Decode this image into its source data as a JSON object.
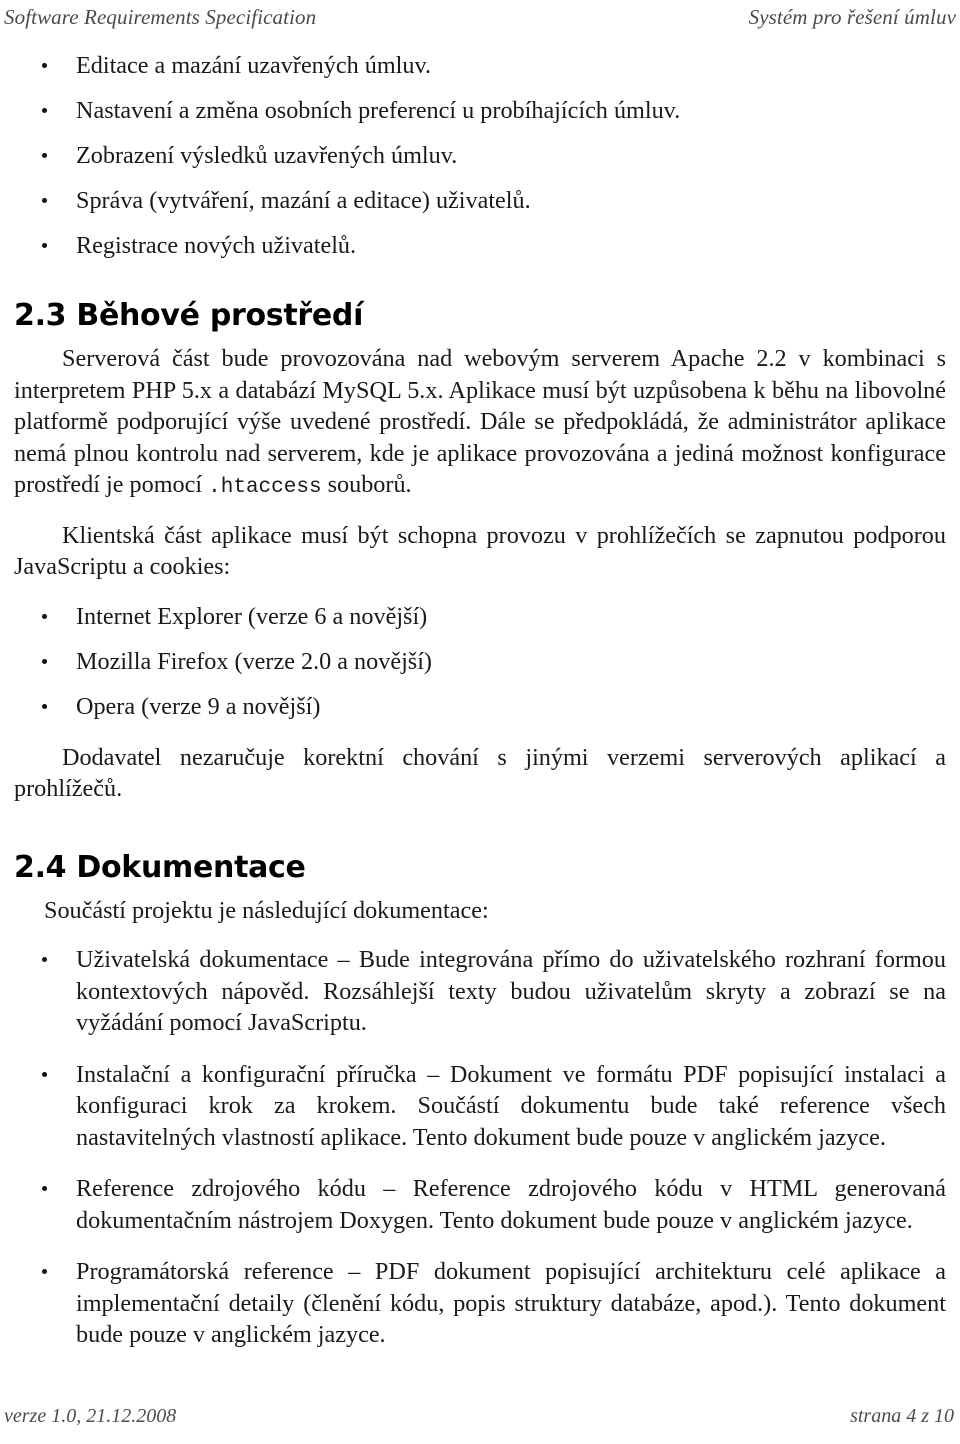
{
  "header": {
    "left": "Software Requirements Specification",
    "right": "Systém pro řešení úmluv"
  },
  "footer": {
    "left": "verze 1.0, 21.12.2008",
    "right": "strana 4 z 10"
  },
  "top_list": {
    "items": [
      "Editace a mazání uzavřených úmluv.",
      "Nastavení a změna osobních preferencí u probíhajících úmluv.",
      "Zobrazení výsledků uzavřených úmluv.",
      "Správa (vytváření, mazání a editace) uživatelů.",
      "Registrace nových uživatelů."
    ]
  },
  "section_23": {
    "heading": "2.3 Běhové prostředí",
    "para1_before_code": "Serverová část bude provozována nad webovým serverem Apache 2.2 v kombinaci s interpretem PHP 5.x a databází MySQL 5.x. Aplikace musí být uzpůsobena k běhu na libovolné platformě podporující výše uvedené prostředí. Dále se předpokládá, že administrátor aplikace nemá plnou kontrolu nad serverem, kde je aplikace provozována a jediná možnost konfigurace prostředí je pomocí ",
    "para1_code": ".htaccess",
    "para1_after_code": " souborů.",
    "para2": "Klientská část aplikace musí být schopna provozu v prohlížečích se zapnutou podporou JavaScriptu a cookies:",
    "browsers": [
      "Internet Explorer (verze 6 a novější)",
      "Mozilla Firefox (verze 2.0 a novější)",
      "Opera (verze 9 a novější)"
    ],
    "para3": "Dodavatel nezaručuje korektní chování s jinými verzemi serverových aplikací a prohlížečů."
  },
  "section_24": {
    "heading": "2.4 Dokumentace",
    "intro": "Součástí projektu je následující dokumentace:",
    "docs": [
      "Uživatelská dokumentace – Bude integrována přímo do uživatelského rozhraní formou kontextových nápověd. Rozsáhlejší texty budou uživatelům skryty a zobrazí se na vyžádání pomocí JavaScriptu.",
      "Instalační a konfigurační příručka – Dokument ve formátu PDF popisující instalaci a konfiguraci krok za krokem. Součástí dokumentu bude také reference všech nastavitelných vlastností aplikace. Tento dokument bude pouze v anglickém jazyce.",
      "Reference zdrojového kódu – Reference zdrojového kódu v HTML generovaná dokumentačním nástrojem Doxygen. Tento dokument bude pouze v anglickém jazyce.",
      "Programátorská reference – PDF dokument popisující architekturu celé aplikace a implementační detaily (členění kódu, popis struktury databáze, apod.). Tento dokument bude pouze v anglickém jazyce."
    ]
  }
}
